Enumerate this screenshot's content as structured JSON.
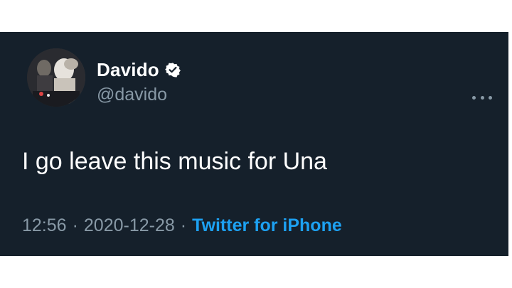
{
  "tweet": {
    "display_name": "Davido",
    "handle": "@davido",
    "verified": true,
    "text": "I go leave this music for Una",
    "time": "12:56",
    "date": "2020-12-28",
    "separator": "·",
    "source": "Twitter for iPhone"
  },
  "icons": {
    "verified": "verified-badge-icon",
    "more": "more-options-icon"
  },
  "colors": {
    "background": "#15202b",
    "primary_text": "#ffffff",
    "secondary_text": "#8899a6",
    "accent": "#1da1f2"
  }
}
